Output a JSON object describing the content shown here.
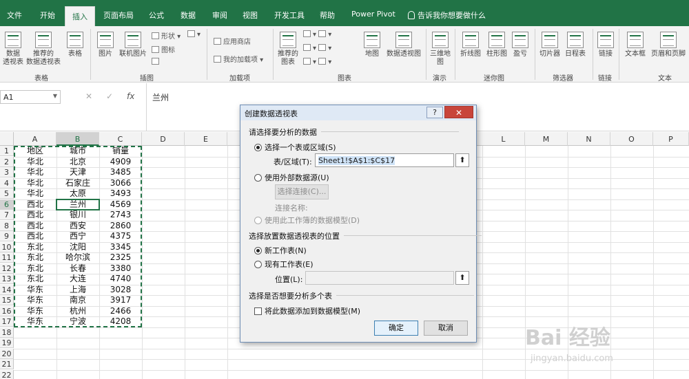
{
  "ribbon_tabs": [
    "文件",
    "开始",
    "插入",
    "页面布局",
    "公式",
    "数据",
    "审阅",
    "视图",
    "开发工具",
    "帮助",
    "Power Pivot"
  ],
  "active_tab": "插入",
  "tell_me": "告诉我你想要做什么",
  "ribbon": {
    "pivot_table": "数据\n透视表",
    "recommended_pivot": "推荐的\n数据透视表",
    "table": "表格",
    "picture": "图片",
    "online_picture": "联机图片",
    "shapes": "形状",
    "icons": "图标",
    "app_store": "应用商店",
    "my_addins": "我的加载项",
    "recommended_charts": "推荐的\n图表",
    "map": "地图",
    "pivot_chart": "数据透视图",
    "three_d_map": "三维地\n图",
    "line": "折线图",
    "column": "柱形图",
    "win_loss": "盈亏",
    "slicer": "切片器",
    "timeline": "日程表",
    "link": "链接",
    "textbox": "文本框",
    "header_footer": "页眉和页脚",
    "groups": {
      "tables": "表格",
      "illustrations": "插图",
      "addins": "加载项",
      "charts": "图表",
      "tours": "演示",
      "sparklines": "迷你图",
      "filters": "筛选器",
      "links": "链接",
      "text": "文本"
    }
  },
  "formula_bar": {
    "name_box": "A1",
    "fx": "fx",
    "content": "兰州"
  },
  "columns": [
    "A",
    "B",
    "C",
    "D",
    "E",
    "L",
    "M",
    "N",
    "O",
    "P"
  ],
  "rows": [
    "1",
    "2",
    "3",
    "4",
    "5",
    "6",
    "7",
    "8",
    "9",
    "10",
    "11",
    "12",
    "13",
    "14",
    "15",
    "16",
    "17",
    "18",
    "19",
    "20",
    "21",
    "22"
  ],
  "table": [
    [
      "地区",
      "城市",
      "销量"
    ],
    [
      "华北",
      "北京",
      "4909"
    ],
    [
      "华北",
      "天津",
      "3485"
    ],
    [
      "华北",
      "石家庄",
      "3066"
    ],
    [
      "华北",
      "太原",
      "3493"
    ],
    [
      "西北",
      "兰州",
      "4569"
    ],
    [
      "西北",
      "银川",
      "2743"
    ],
    [
      "西北",
      "西安",
      "2860"
    ],
    [
      "西北",
      "西宁",
      "4375"
    ],
    [
      "东北",
      "沈阳",
      "3345"
    ],
    [
      "东北",
      "哈尔滨",
      "2325"
    ],
    [
      "东北",
      "长春",
      "3380"
    ],
    [
      "东北",
      "大连",
      "4740"
    ],
    [
      "华东",
      "上海",
      "3028"
    ],
    [
      "华东",
      "南京",
      "3917"
    ],
    [
      "华东",
      "杭州",
      "2466"
    ],
    [
      "华东",
      "宁波",
      "4208"
    ]
  ],
  "dialog": {
    "title": "创建数据透视表",
    "help": "?",
    "close": "✕",
    "section1": "请选择要分析的数据",
    "opt_table_range": "选择一个表或区域(S)",
    "range_label": "表/区域(T):",
    "range_value": "Sheet1!$A$1:$C$17",
    "opt_external": "使用外部数据源(U)",
    "choose_connection": "选择连接(C)...",
    "connection_name": "连接名称:",
    "opt_data_model": "使用此工作簿的数据模型(D)",
    "section2": "选择放置数据透视表的位置",
    "opt_new_sheet": "新工作表(N)",
    "opt_existing_sheet": "现有工作表(E)",
    "location_label": "位置(L):",
    "location_value": "",
    "section3": "选择是否想要分析多个表",
    "add_to_model": "将此数据添加到数据模型(M)",
    "ok": "确定",
    "cancel": "取消"
  },
  "watermark": "Bai 经验",
  "watermark_url": "jingyan.baidu.com",
  "colors": {
    "excel_green": "#217346",
    "ribbon_bg": "#f3f3f3",
    "dialog_bg": "#f0f0f0",
    "close_red": "#c8453b"
  }
}
